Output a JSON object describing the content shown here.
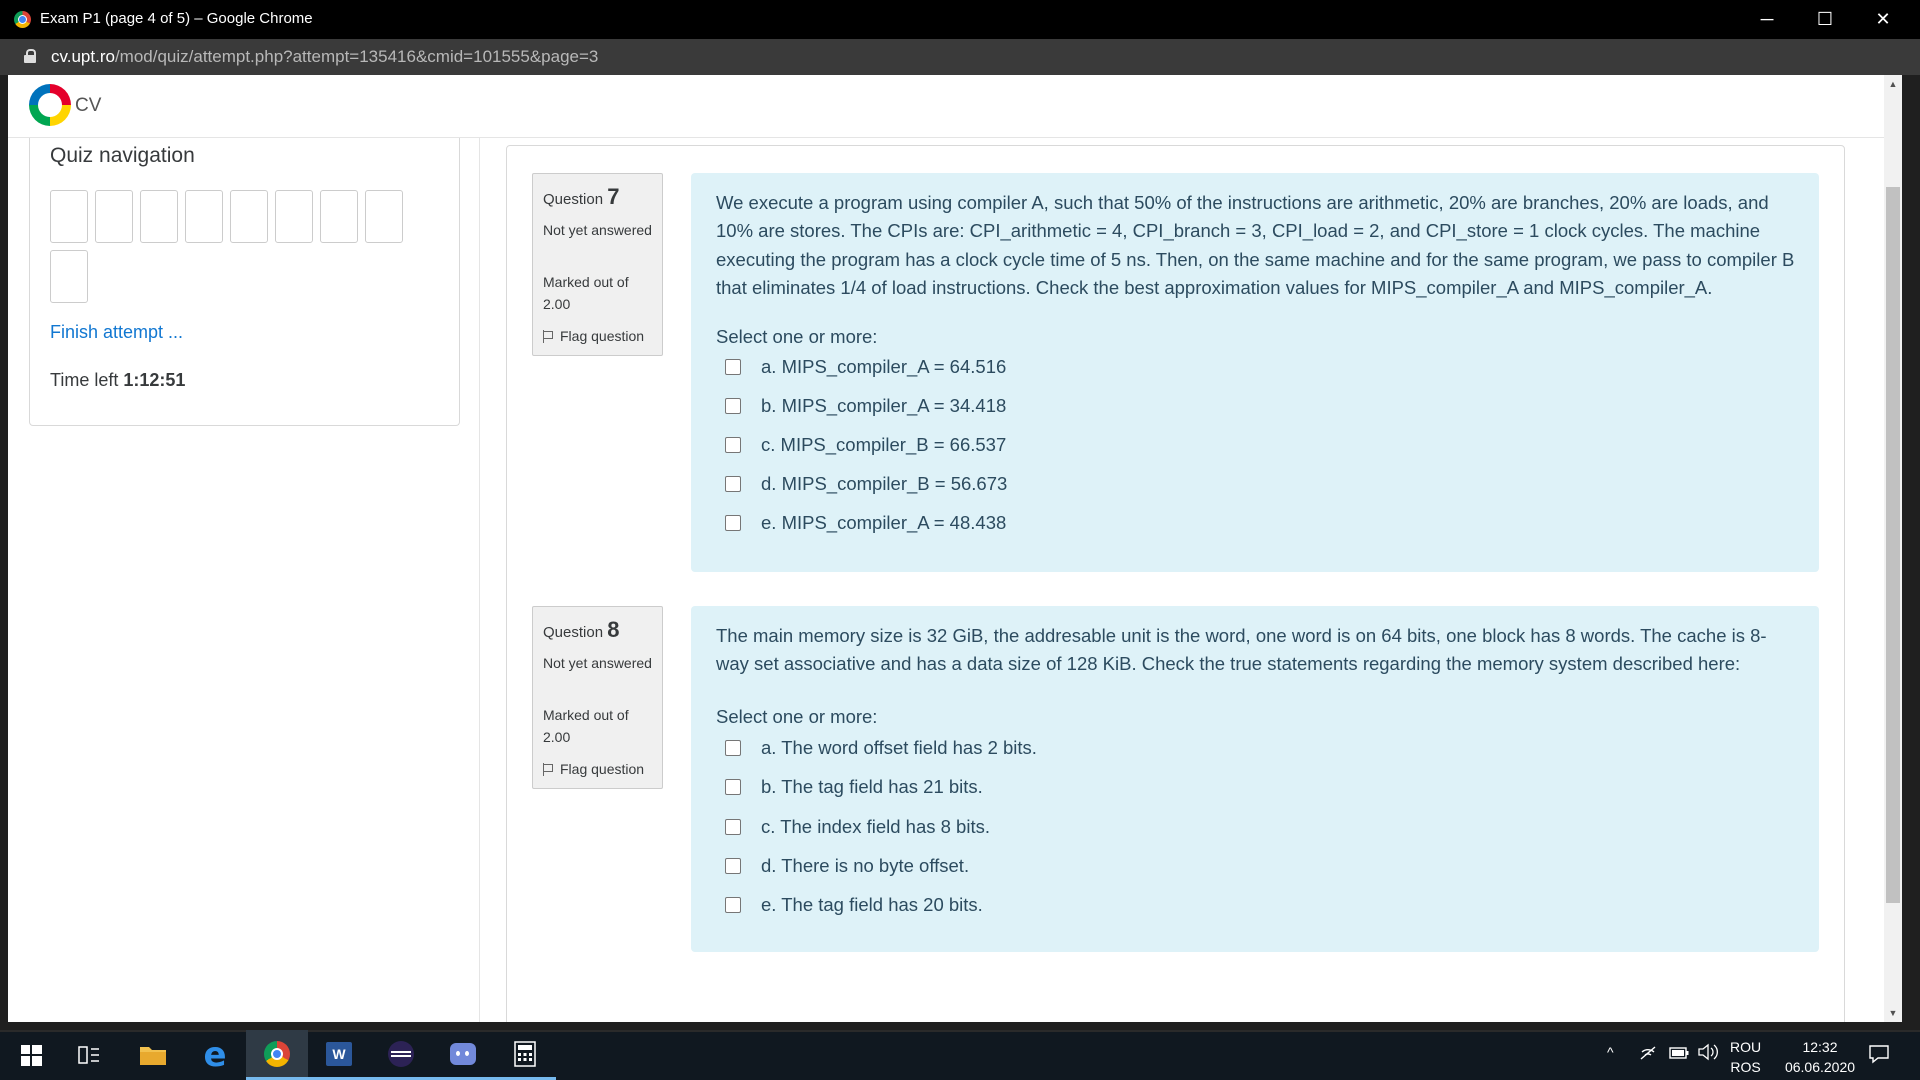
{
  "window": {
    "title": "Exam P1 (page 4 of 5) – Google Chrome",
    "minimize": "─",
    "maximize": "☐",
    "close": "✕"
  },
  "address": {
    "host": "cv.upt.ro",
    "path": "/mod/quiz/attempt.php?attempt=135416&cmid=101555&page=3"
  },
  "site": {
    "brand": "CV"
  },
  "quiz_nav": {
    "title": "Quiz navigation",
    "finish_label": "Finish attempt ...",
    "time_left_label": "Time left",
    "time_left_value": "1:12:51",
    "question_buttons": 9
  },
  "questions": [
    {
      "label": "Question",
      "number": "7",
      "state": "Not yet answered",
      "grade": "Marked out of 2.00",
      "flag_label": "Flag question",
      "text": "We execute a program using compiler A, such that 50% of the instructions are arithmetic, 20% are branches, 20% are loads, and 10% are stores. The CPIs are: CPI_arithmetic = 4, CPI_branch = 3, CPI_load = 2, and CPI_store = 1 clock cycles. The machine executing the program has a clock cycle time of 5 ns. Then, on the same machine and for the same program, we pass to compiler B that eliminates 1/4 of load instructions. Check the best approximation values for MIPS_compiler_A and MIPS_compiler_A.",
      "prompt": "Select one or more:",
      "options": [
        "a. MIPS_compiler_A = 64.516",
        "b. MIPS_compiler_A = 34.418",
        "c. MIPS_compiler_B = 66.537",
        "d. MIPS_compiler_B = 56.673",
        "e. MIPS_compiler_A = 48.438"
      ]
    },
    {
      "label": "Question",
      "number": "8",
      "state": "Not yet answered",
      "grade": "Marked out of 2.00",
      "flag_label": "Flag question",
      "text": "The main memory size is 32 GiB, the addresable unit is the word, one word is on 64 bits, one block has 8 words. The cache is 8-way set associative and has a data size of 128 KiB. Check the true statements regarding the memory system described here:",
      "prompt": "Select one or more:",
      "options": [
        "a. The word offset field has 2 bits.",
        "b. The tag field has 21 bits.",
        "c. The index field has 8 bits.",
        "d. There is no byte offset.",
        "e. The tag field has 20 bits."
      ]
    }
  ],
  "taskbar": {
    "lang_top": "ROU",
    "lang_bottom": "ROS",
    "time": "12:32",
    "date": "06.06.2020"
  },
  "colors": {
    "link": "#1177d1",
    "question_bg": "#def2f8",
    "info_bg": "#f0f0f0"
  }
}
